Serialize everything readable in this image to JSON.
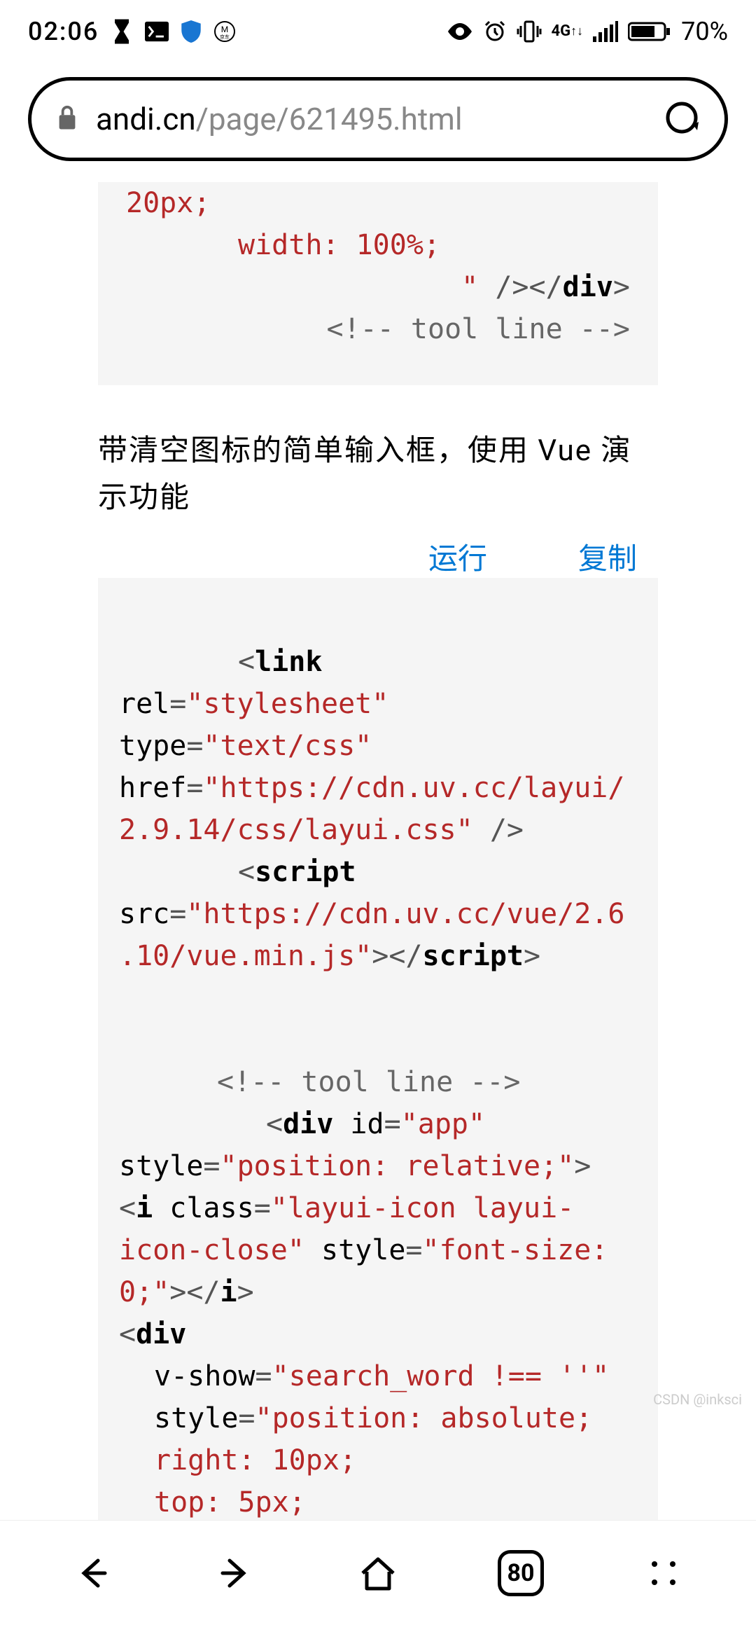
{
  "status": {
    "time": "02:06",
    "battery": "70%",
    "network": "4G"
  },
  "url": {
    "domain": "andi.cn",
    "path": "/page/621495.html"
  },
  "code1": {
    "line1": "20px;",
    "line2_attr": "width:",
    "line2_val": " 100%;",
    "line3_q": "\"",
    "line3_close": " /></",
    "line3_tag": "div",
    "line3_end": ">",
    "comment": "<!-- tool line -->"
  },
  "description": "带清空图标的简单输入框，使用 Vue 演示功能",
  "actions": {
    "run": "运行",
    "copy": "复制"
  },
  "code2": {
    "lt": "<",
    "gt": ">",
    "link_tag": "link",
    "rel": "rel",
    "rel_val": "\"stylesheet\"",
    "type": "type",
    "type_val": "\"text/css\"",
    "href": "href",
    "href_val": "\"https://cdn.uv.cc/layui/2.9.14/css/layui.css\"",
    "link_close": " />",
    "script_tag": "script",
    "src": "src",
    "src_val": "\"https://cdn.uv.cc/vue/2.6.10/vue.min.js\"",
    "script_close": "></",
    "script_end": ">",
    "comment2": "<!-- tool line -->",
    "div_tag": "div",
    "id": " id",
    "id_val": "\"app\"",
    "style": "style",
    "style_val1": "\"position: relative;\"",
    "i_tag": "i",
    "class": " class",
    "class_val": "\"layui-icon layui-icon-close\"",
    "style_val2": "\"font-size: 0;\"",
    "i_close": "></",
    "i_end": ">",
    "vshow": "v-show",
    "vshow_val": "\"search_word !== ''\"",
    "style_val3": "\"position: absolute;",
    "right_line": "right: 10px;",
    "top_line": "top: 5px;"
  },
  "bottom": {
    "tabs": "80"
  },
  "watermark": "CSDN @inksci"
}
